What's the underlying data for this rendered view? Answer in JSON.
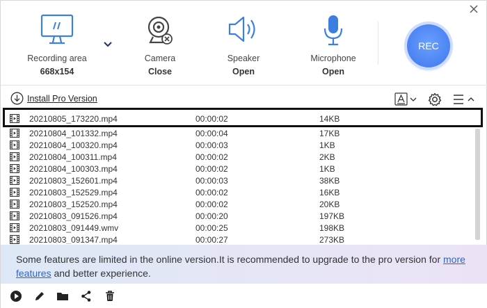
{
  "controls": {
    "recording_area": {
      "label": "Recording area",
      "value": "668x154"
    },
    "camera": {
      "label": "Camera",
      "value": "Close"
    },
    "speaker": {
      "label": "Speaker",
      "value": "Open"
    },
    "microphone": {
      "label": "Microphone",
      "value": "Open"
    },
    "rec_label": "REC"
  },
  "toolbar": {
    "install_label": "Install Pro Version"
  },
  "files": [
    {
      "name": "20210805_173220.mp4",
      "duration": "00:00:02",
      "size": "14KB"
    },
    {
      "name": "20210804_101332.mp4",
      "duration": "00:00:04",
      "size": "17KB"
    },
    {
      "name": "20210804_100320.mp4",
      "duration": "00:00:03",
      "size": "1KB"
    },
    {
      "name": "20210804_100311.mp4",
      "duration": "00:00:02",
      "size": "2KB"
    },
    {
      "name": "20210804_100303.mp4",
      "duration": "00:00:02",
      "size": "1KB"
    },
    {
      "name": "20210803_152601.mp4",
      "duration": "00:00:03",
      "size": "38KB"
    },
    {
      "name": "20210803_152529.mp4",
      "duration": "00:00:02",
      "size": "16KB"
    },
    {
      "name": "20210803_152520.mp4",
      "duration": "00:00:02",
      "size": "20KB"
    },
    {
      "name": "20210803_091526.mp4",
      "duration": "00:00:20",
      "size": "197KB"
    },
    {
      "name": "20210803_091449.wmv",
      "duration": "00:00:25",
      "size": "198KB"
    },
    {
      "name": "20210803_091347.mp4",
      "duration": "00:00:27",
      "size": "273KB"
    }
  ],
  "banner": {
    "text_before": "Some features are limited in the online version.It is recommended to upgrade to the pro version for ",
    "link_text": "more features",
    "text_after": " and better experience."
  },
  "colors": {
    "accent": "#3d7fe0",
    "rec": "#4b82f2",
    "banner_start": "#dde8f7",
    "banner_end": "#ece2f6"
  },
  "icons": {
    "close": "close-icon",
    "monitor": "monitor-icon",
    "camera": "webcam-icon",
    "speaker": "speaker-icon",
    "microphone": "microphone-icon",
    "download": "download-icon",
    "font": "font-icon",
    "gear": "gear-icon",
    "menu": "menu-icon",
    "play": "play-icon",
    "edit": "pencil-icon",
    "folder": "folder-icon",
    "share": "share-icon",
    "delete": "trash-icon"
  }
}
